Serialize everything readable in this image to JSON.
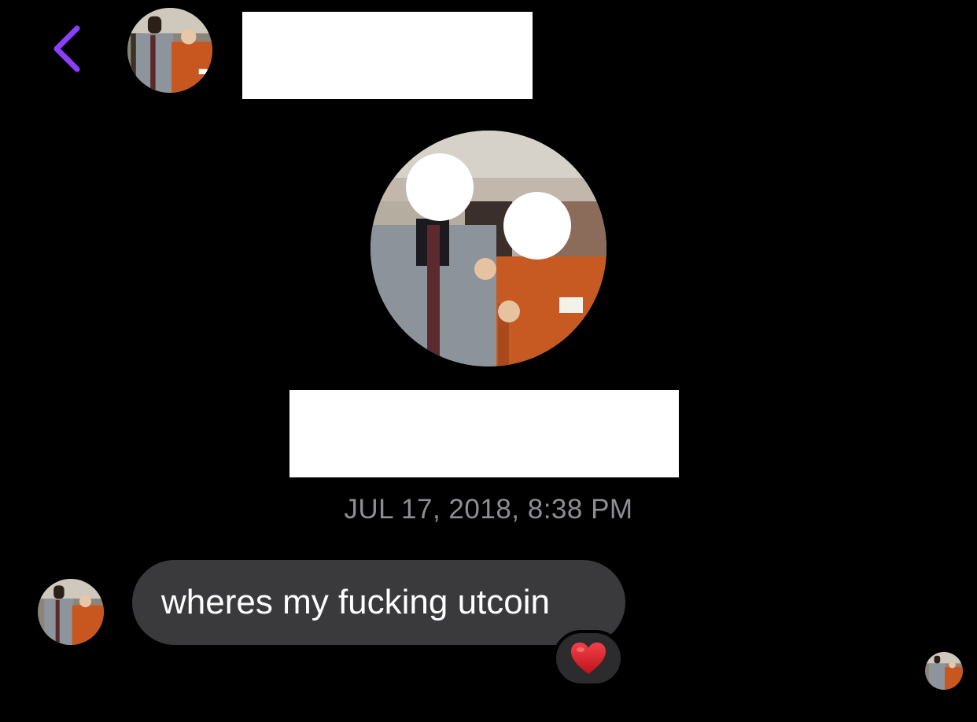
{
  "header": {
    "back_icon": "chevron-left-icon",
    "accent_color": "#8a3ffc"
  },
  "conversation": {
    "timestamp": "JUL 17, 2018, 8:38 PM"
  },
  "messages": [
    {
      "text": "wheres my fucking utcoin",
      "reaction": "❤️",
      "bubble_color": "#3a3a3c"
    }
  ]
}
